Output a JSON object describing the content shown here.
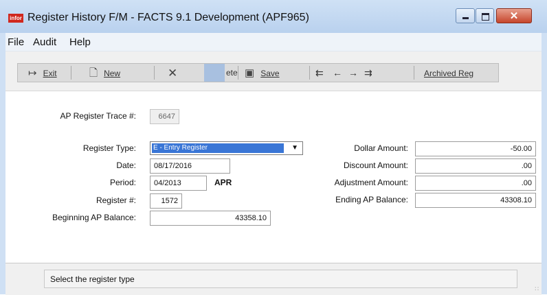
{
  "window": {
    "title": "Register History F/M - FACTS 9.1 Development (APF965)",
    "app_badge": "infor",
    "close_glyph": "✕"
  },
  "menu": [
    "File",
    "Audit",
    "Help"
  ],
  "toolbar": {
    "exit_label": "Exit",
    "exit_icon": "exit-door-icon",
    "new_label": "New",
    "new_icon": "new-document-icon",
    "delete_label": "ete",
    "delete_icon": "delete-x-icon",
    "save_label": "Save",
    "save_icon": "floppy-disk-icon",
    "first_icon": "first-record-icon",
    "prev_icon": "previous-record-icon",
    "next_icon": "next-record-icon",
    "last_icon": "last-record-icon",
    "archived_label": "Archived Reg"
  },
  "form": {
    "trace": {
      "label": "AP Register Trace #:",
      "value": "6647"
    },
    "register_type": {
      "label": "Register Type:",
      "value": "E - Entry Register"
    },
    "date": {
      "label": "Date:",
      "value": "08/17/2016"
    },
    "period": {
      "label": "Period:",
      "value": "04/2013",
      "month": "APR"
    },
    "register_no": {
      "label": "Register #:",
      "value": "1572"
    },
    "beginning_balance": {
      "label": "Beginning AP Balance:",
      "value": "43358.10"
    },
    "dollar_amount": {
      "label": "Dollar Amount:",
      "value": "-50.00"
    },
    "discount_amount": {
      "label": "Discount Amount:",
      "value": ".00"
    },
    "adjustment_amount": {
      "label": "Adjustment Amount:",
      "value": ".00"
    },
    "ending_balance": {
      "label": "Ending AP Balance:",
      "value": "43308.10"
    }
  },
  "status": {
    "message": "Select the register type"
  }
}
